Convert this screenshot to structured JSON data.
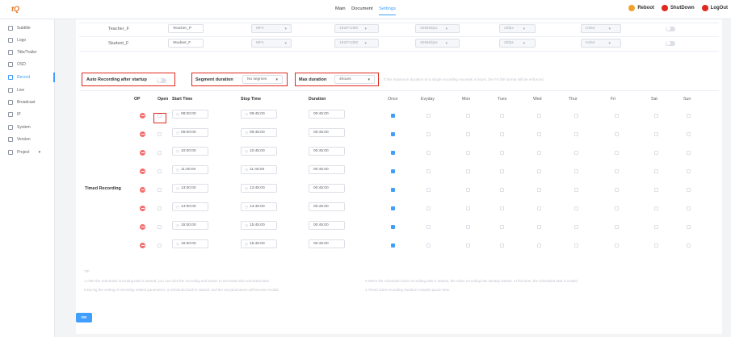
{
  "app": {
    "logo": "tQ"
  },
  "nav": {
    "tabs": [
      "Main",
      "Document",
      "Settings"
    ],
    "active": "Settings"
  },
  "topright": {
    "reboot": "Reboot",
    "shutdown": "ShutDown",
    "logout": "LogOut",
    "colors": {
      "reboot": "#f0a22e",
      "shutdown": "#e0291d",
      "logout": "#e0291d"
    }
  },
  "sidebar": {
    "items": [
      "Subtitle",
      "Logo",
      "Title/Trailer",
      "OSD",
      "Record",
      "Live",
      "Broadcast",
      "IP",
      "System",
      "Version",
      "Project"
    ],
    "active": "Record"
  },
  "streams": [
    {
      "name": "Teacher_F",
      "file": "Teacher_P",
      "format": "MF4",
      "resolution": "1920*1080",
      "bitrate": "4096Kbps",
      "fps": "25fps",
      "codec": "H264"
    },
    {
      "name": "Student_F",
      "file": "Studnet_F",
      "format": "MF4",
      "resolution": "1920*1080",
      "bitrate": "4096Kbps",
      "fps": "25fps",
      "codec": "H264"
    }
  ],
  "settings": {
    "auto_label": "Auto Recording after startup",
    "segment_label": "Segment duration",
    "segment_value": "No segmen",
    "max_label": "Max duration",
    "max_value": "4hours",
    "max_hint": "If the maximum duration of a single recording exceeds 4 hours, the FS file format will be enforced."
  },
  "schedule": {
    "section_label": "Timed Recording",
    "columns": [
      "OP",
      "Open",
      "Start Time",
      "Stop Time",
      "Duration",
      "Once",
      "Evyday",
      "Mon",
      "Tues",
      "Wed",
      "Thur",
      "Fri",
      "Sat",
      "Sun"
    ],
    "rows": [
      {
        "start": "08:00:00",
        "stop": "08:45:00",
        "duration": "00:45:00",
        "once": true
      },
      {
        "start": "09:00:00",
        "stop": "09:45:00",
        "duration": "00:45:00",
        "once": true
      },
      {
        "start": "10:00:00",
        "stop": "10:45:00",
        "duration": "00:45:00",
        "once": true
      },
      {
        "start": "11:00:00",
        "stop": "11:45:00",
        "duration": "00:45:00",
        "once": true
      },
      {
        "start": "13:00:00",
        "stop": "13:45:00",
        "duration": "00:45:00",
        "once": true
      },
      {
        "start": "14:00:00",
        "stop": "14:45:00",
        "duration": "00:45:00",
        "once": true
      },
      {
        "start": "15:00:00",
        "stop": "15:45:00",
        "duration": "00:45:00",
        "once": true
      },
      {
        "start": "16:00:00",
        "stop": "16:45:00",
        "duration": "00:45:00",
        "once": true
      }
    ]
  },
  "tips": {
    "title": "TIP",
    "t1": "1.After the scheduled recording task is started, you can click the recording end button to terminate this scheduled task.",
    "t2": "2.When the scheduled video recording task is started, the video recording has already started. At this time, the scheduled task is invalid.",
    "t3": "3.During the setting of recording related parameters, a scheduled task is started, and the set parameters will become invalid.",
    "t4": "4.Timed video recording duration includes pause time."
  },
  "ok_label": "OK"
}
